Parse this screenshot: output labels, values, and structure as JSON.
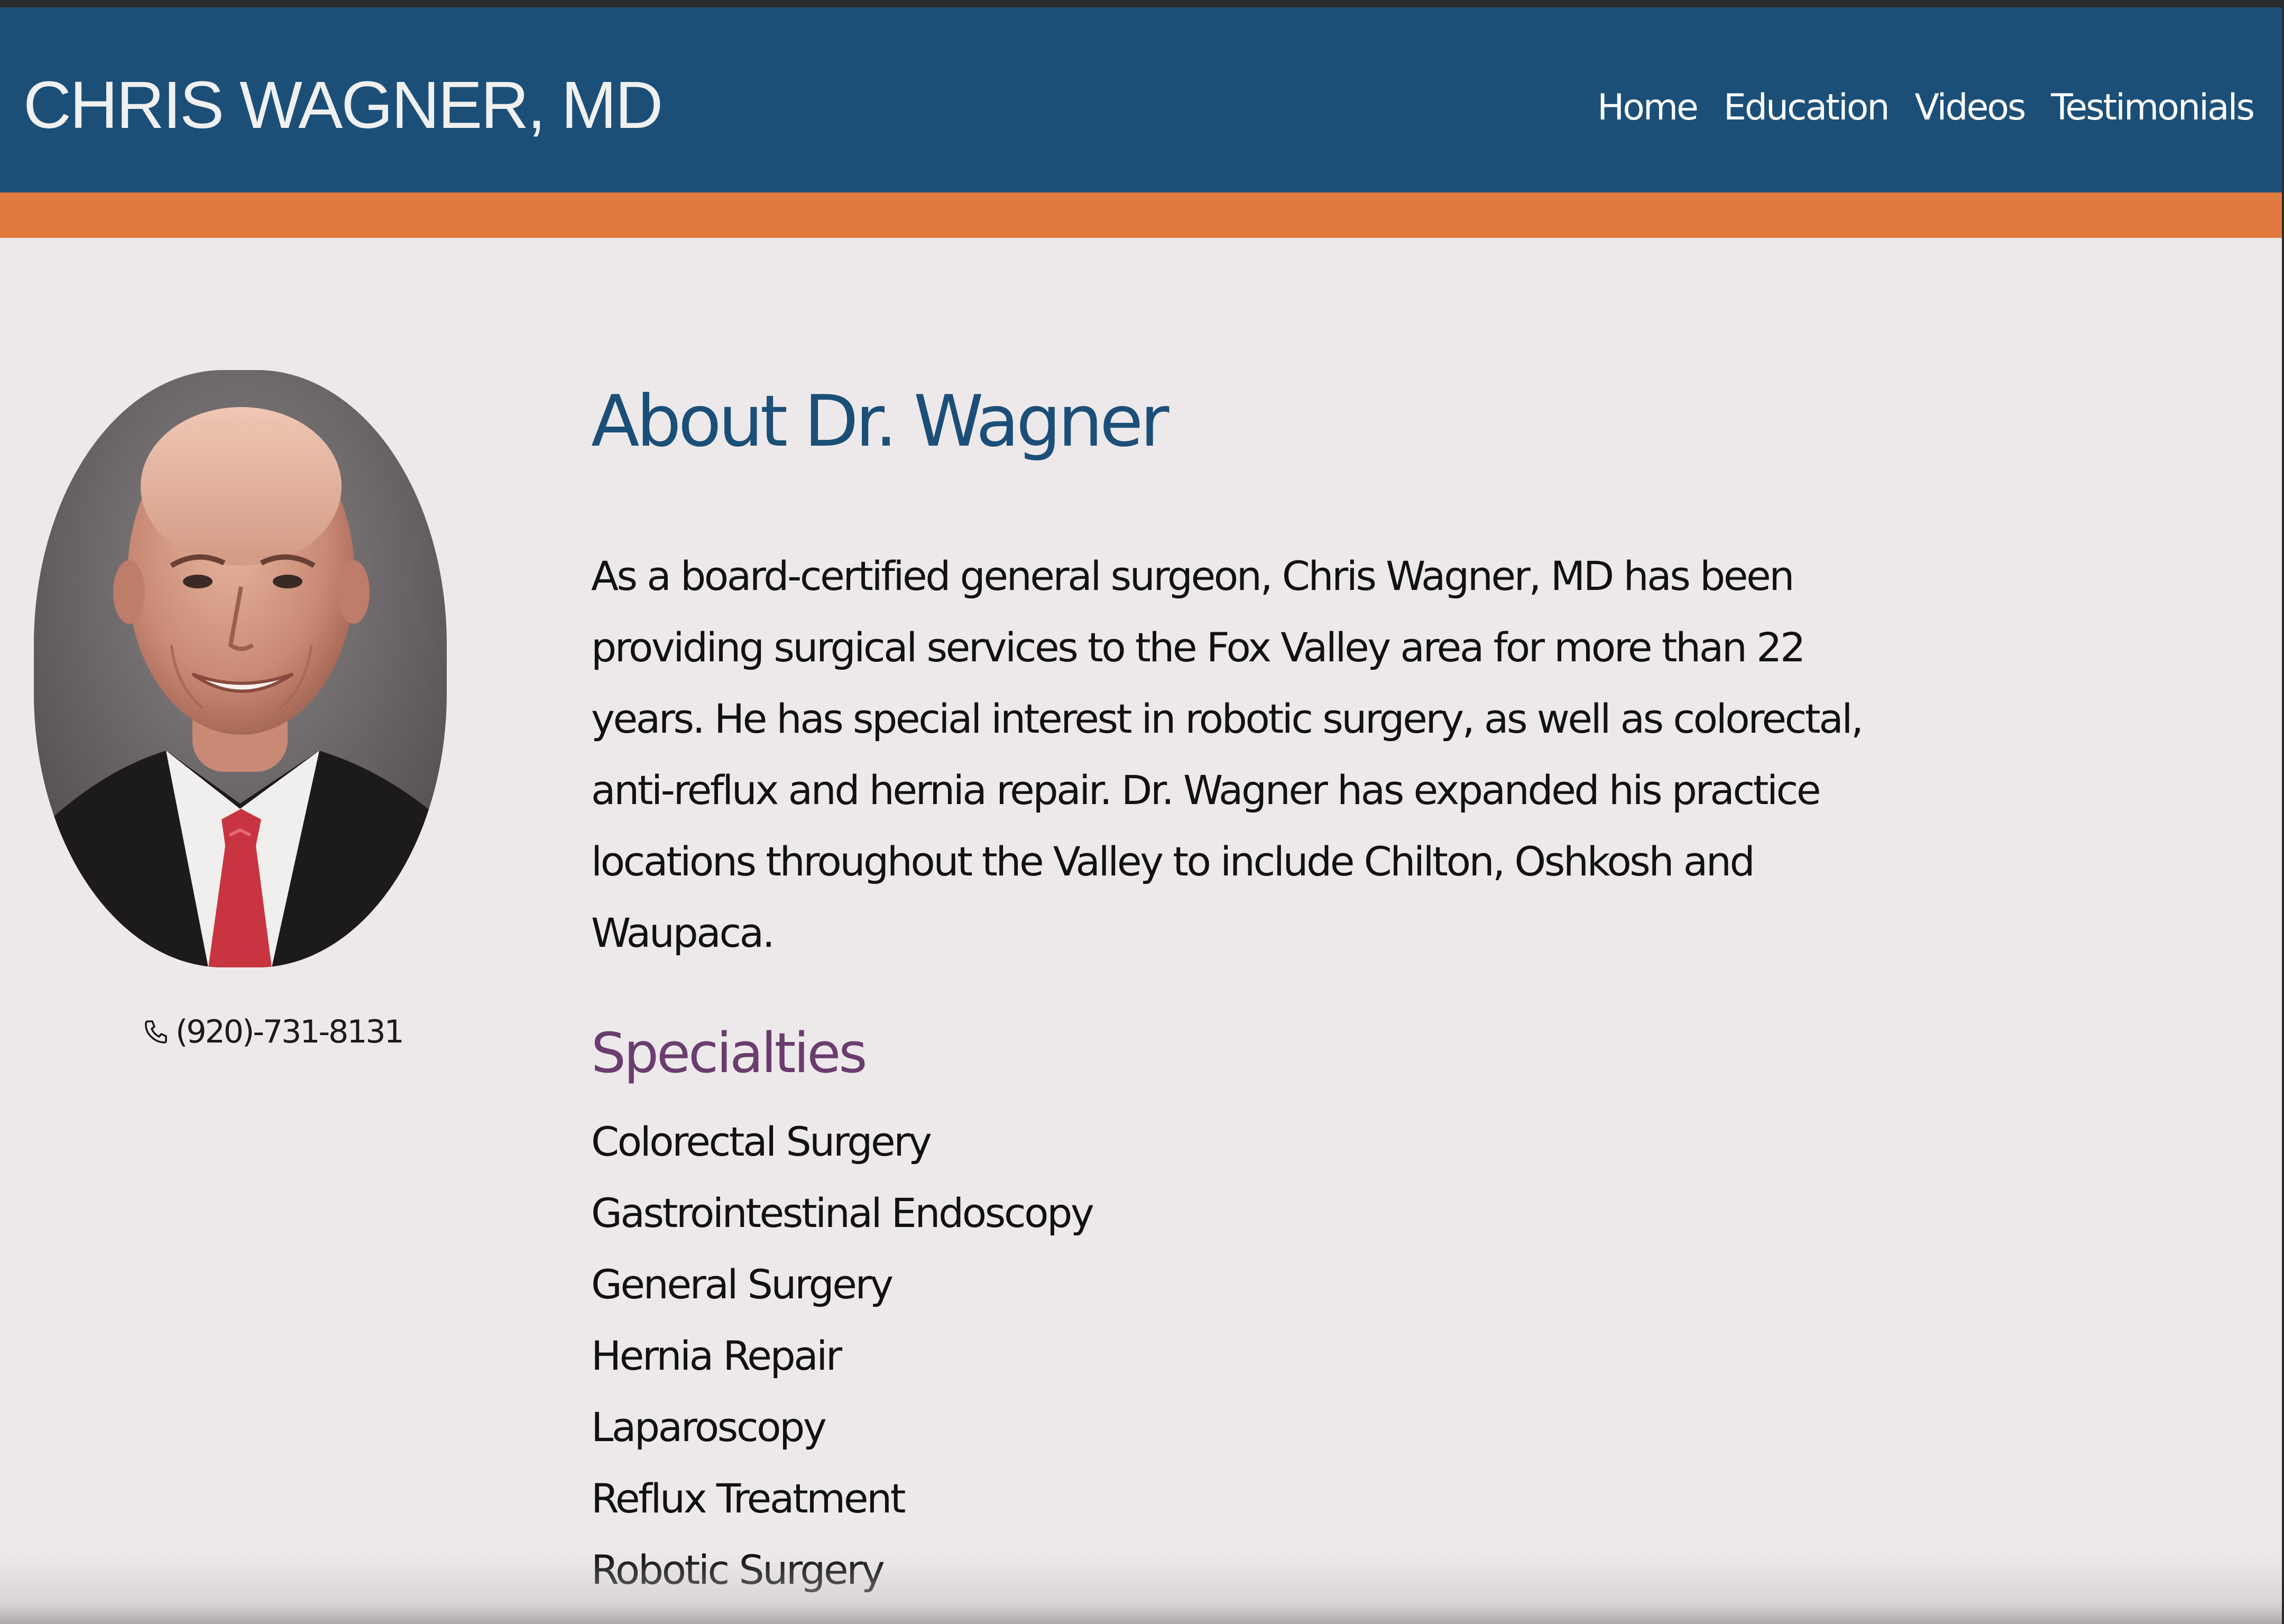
{
  "header": {
    "brand": "CHRIS WAGNER, MD",
    "nav": [
      {
        "label": "Home"
      },
      {
        "label": "Education"
      },
      {
        "label": "Videos"
      },
      {
        "label": "Testimonials"
      }
    ]
  },
  "profile": {
    "phone": "(920)-731-8131",
    "phone_icon": "phone-icon"
  },
  "about": {
    "title": "About Dr. Wagner",
    "body": "As a board-certified general surgeon, Chris Wagner, MD has been providing surgical services to the Fox Valley area for more than 22 years. He has special interest in robotic surgery, as well as colorectal, anti-reflux and hernia repair. Dr. Wagner has expanded his practice locations throughout the Valley to include Chilton, Oshkosh and Waupaca."
  },
  "specialties": {
    "title": "Specialties",
    "items": [
      "Colorectal Surgery",
      "Gastrointestinal Endoscopy",
      "General Surgery",
      "Hernia Repair",
      "Laparoscopy",
      "Reflux Treatment",
      "Robotic Surgery"
    ]
  },
  "colors": {
    "header_blue": "#1b4f78",
    "accent_orange": "#e07a3e",
    "background": "#ede9ea",
    "specialties_purple": "#6a3d6e"
  }
}
